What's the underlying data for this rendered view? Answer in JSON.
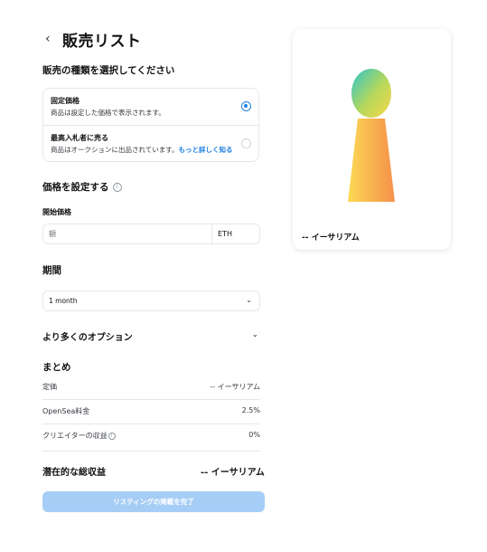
{
  "header": {
    "back_icon": "chevron-left-icon",
    "back_glyph": "‹",
    "title": "販売リスト"
  },
  "sale_type": {
    "heading": "販売の種類を選択してください",
    "options": [
      {
        "title": "固定価格",
        "desc": "商品は設定した価格で表示されます。",
        "selected": true
      },
      {
        "title": "最高入札者に売る",
        "desc": "商品はオークションに出品されています。",
        "link": "もっと詳しく知る",
        "selected": false
      }
    ]
  },
  "price": {
    "heading": "価格を設定する",
    "info_icon": "info-icon",
    "start_label": "開始価格",
    "input_placeholder": "額",
    "unit": "ETH"
  },
  "duration": {
    "heading": "期間",
    "value": "1 month",
    "chevron": "⌄"
  },
  "more_options": {
    "label": "より多くのオプション",
    "chevron": "⌄"
  },
  "summary": {
    "heading": "まとめ",
    "rows": [
      {
        "key": "定価",
        "value": "-- イーサリアム"
      },
      {
        "key": "OpenSea料金",
        "value": "2.5%"
      },
      {
        "key": "クリエイターの収益",
        "value": "0%"
      }
    ],
    "total_label": "潜在的な総収益",
    "total_value": "-- イーサリアム"
  },
  "complete_button": "リスティングの掲載を完了",
  "preview": {
    "label": "-- イーサリアム"
  },
  "colors": {
    "accent": "#2081e2",
    "button_disabled": "#a6cdf5"
  }
}
